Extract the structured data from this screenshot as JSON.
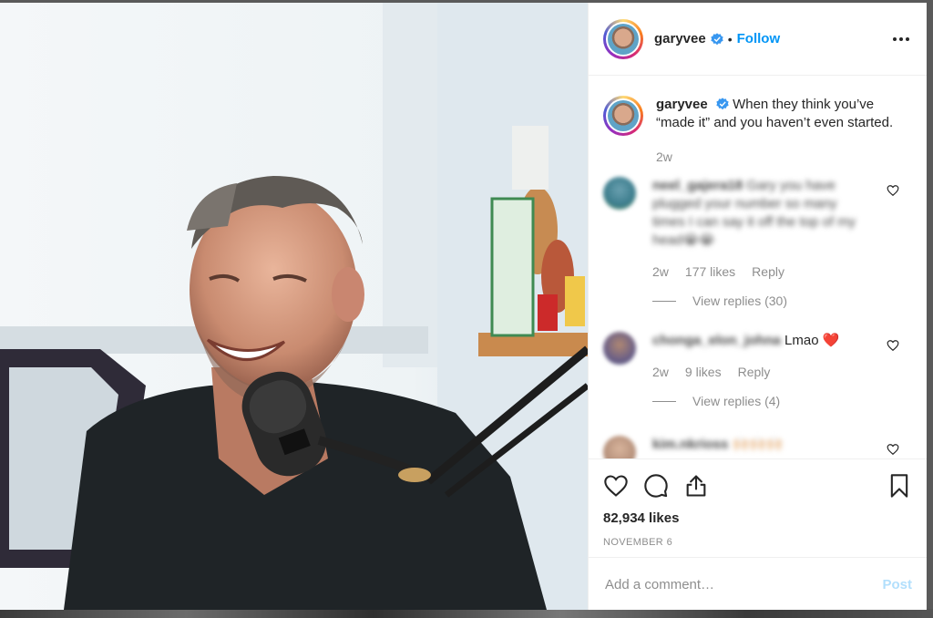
{
  "post": {
    "username": "garyvee",
    "follow_label": "Follow",
    "separator": "•",
    "caption_text": "When they think you’ve “made it” and you haven’t even started.",
    "caption_time": "2w",
    "likes": "82,934 likes",
    "date": "NOVEMBER 6"
  },
  "comments": [
    {
      "username": "neel_gajera18",
      "text": "Gary you have plugged your number so many times I can say it off the top of my head😭😭",
      "time": "2w",
      "likes": "177 likes",
      "reply_label": "Reply",
      "view_replies": "View replies (30)"
    },
    {
      "username": "chonga_elon_johna",
      "text": "Lmao ❤️",
      "time": "2w",
      "likes": "9 likes",
      "reply_label": "Reply",
      "view_replies": "View replies (4)"
    },
    {
      "username": "kim.nkrioss",
      "text": "🙌🏻🙌🏻🙌🏻"
    }
  ],
  "add_comment": {
    "placeholder": "Add a comment…",
    "post_label": "Post"
  },
  "icons": {
    "more": "more-options-icon",
    "like": "heart-icon",
    "comment": "comment-icon",
    "share": "share-icon",
    "save": "bookmark-icon",
    "verified": "verified-badge-icon"
  },
  "colors": {
    "accent": "#0095f6",
    "post_disabled": "#b2dffc",
    "muted": "#8e8e8e"
  }
}
